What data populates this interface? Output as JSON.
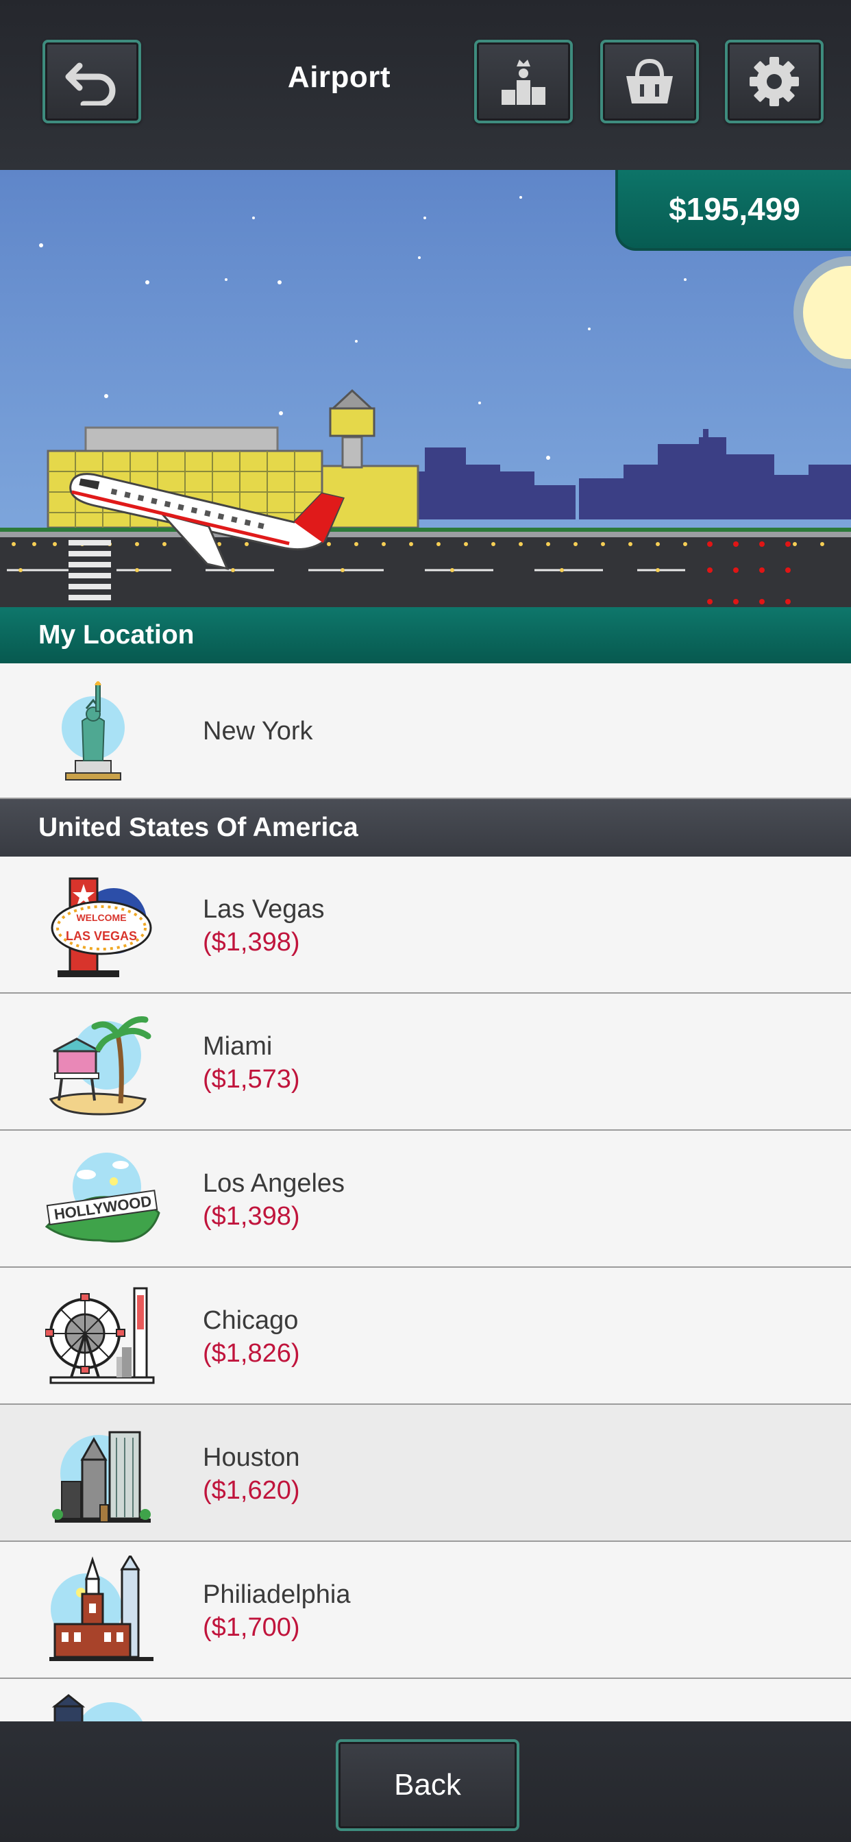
{
  "header": {
    "title": "Airport",
    "back_icon": "undo-arrow-icon",
    "leaderboard_icon": "podium-icon",
    "shop_icon": "shopping-basket-icon",
    "settings_icon": "gear-icon"
  },
  "balance": "$195,499",
  "my_location": {
    "heading": "My Location",
    "city": "New York",
    "icon": "statue-of-liberty-icon"
  },
  "country": {
    "heading": "United States Of America",
    "destinations": [
      {
        "name": "Las  Vegas",
        "price": "($1,398)",
        "icon": "las-vegas-sign-icon"
      },
      {
        "name": "Miami",
        "price": "($1,573)",
        "icon": "miami-lifeguard-palm-icon"
      },
      {
        "name": "Los Angeles",
        "price": "($1,398)",
        "icon": "hollywood-sign-icon"
      },
      {
        "name": "Chicago",
        "price": "($1,826)",
        "icon": "chicago-ferris-wheel-icon"
      },
      {
        "name": "Houston",
        "price": "($1,620)",
        "icon": "houston-skyline-icon"
      },
      {
        "name": "Philiadelphia",
        "price": "($1,700)",
        "icon": "philadelphia-hall-icon"
      }
    ]
  },
  "footer": {
    "back_label": "Back"
  },
  "colors": {
    "accent_teal": "#0e776b",
    "button_border": "#3e8c7e",
    "price_red": "#c0143c",
    "dark_bar": "#2f3238"
  }
}
